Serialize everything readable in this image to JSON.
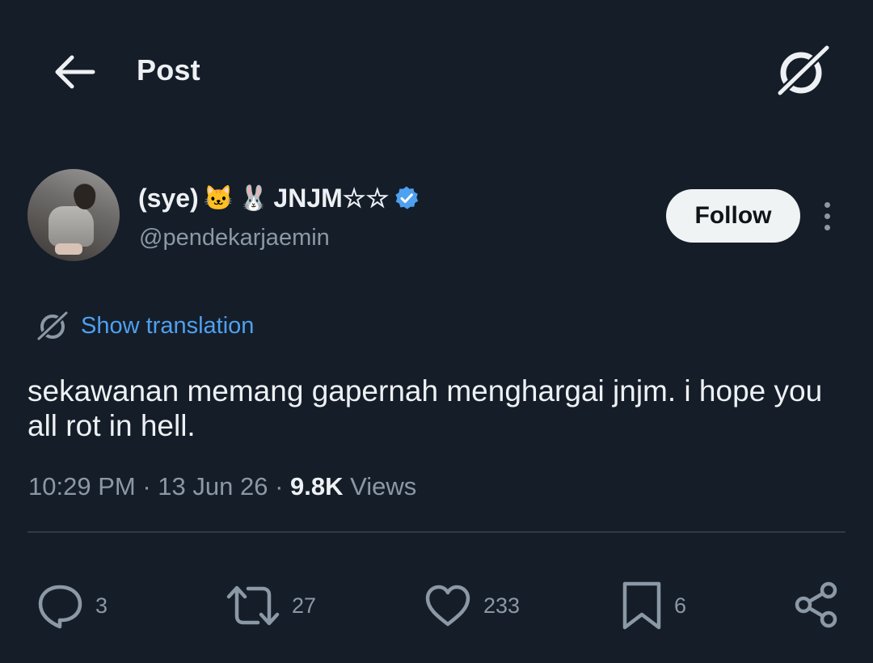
{
  "header": {
    "title": "Post",
    "back_icon": "back-arrow-icon",
    "grok_icon": "grok-icon"
  },
  "author": {
    "display_name": "(sye)",
    "emoji_1": "🐱",
    "emoji_2": "🐰",
    "name_suffix": "JNJM☆☆",
    "verified": true,
    "handle": "@pendekarjaemin"
  },
  "follow_button": {
    "label": "Follow"
  },
  "translation": {
    "label": "Show translation"
  },
  "tweet": {
    "text": "sekawanan memang gapernah menghargai jnjm. i hope you all rot in hell.",
    "time": "10:29 PM",
    "date": "13 Jun 26",
    "views_count": "9.8K",
    "views_label": "Views"
  },
  "actions": {
    "reply_count": "3",
    "retweet_count": "27",
    "like_count": "233",
    "bookmark_count": "6"
  },
  "colors": {
    "background": "#151d28",
    "accent_blue": "#4ea0f0",
    "muted_text": "#8b98a5",
    "follow_bg": "#eff3f4"
  }
}
